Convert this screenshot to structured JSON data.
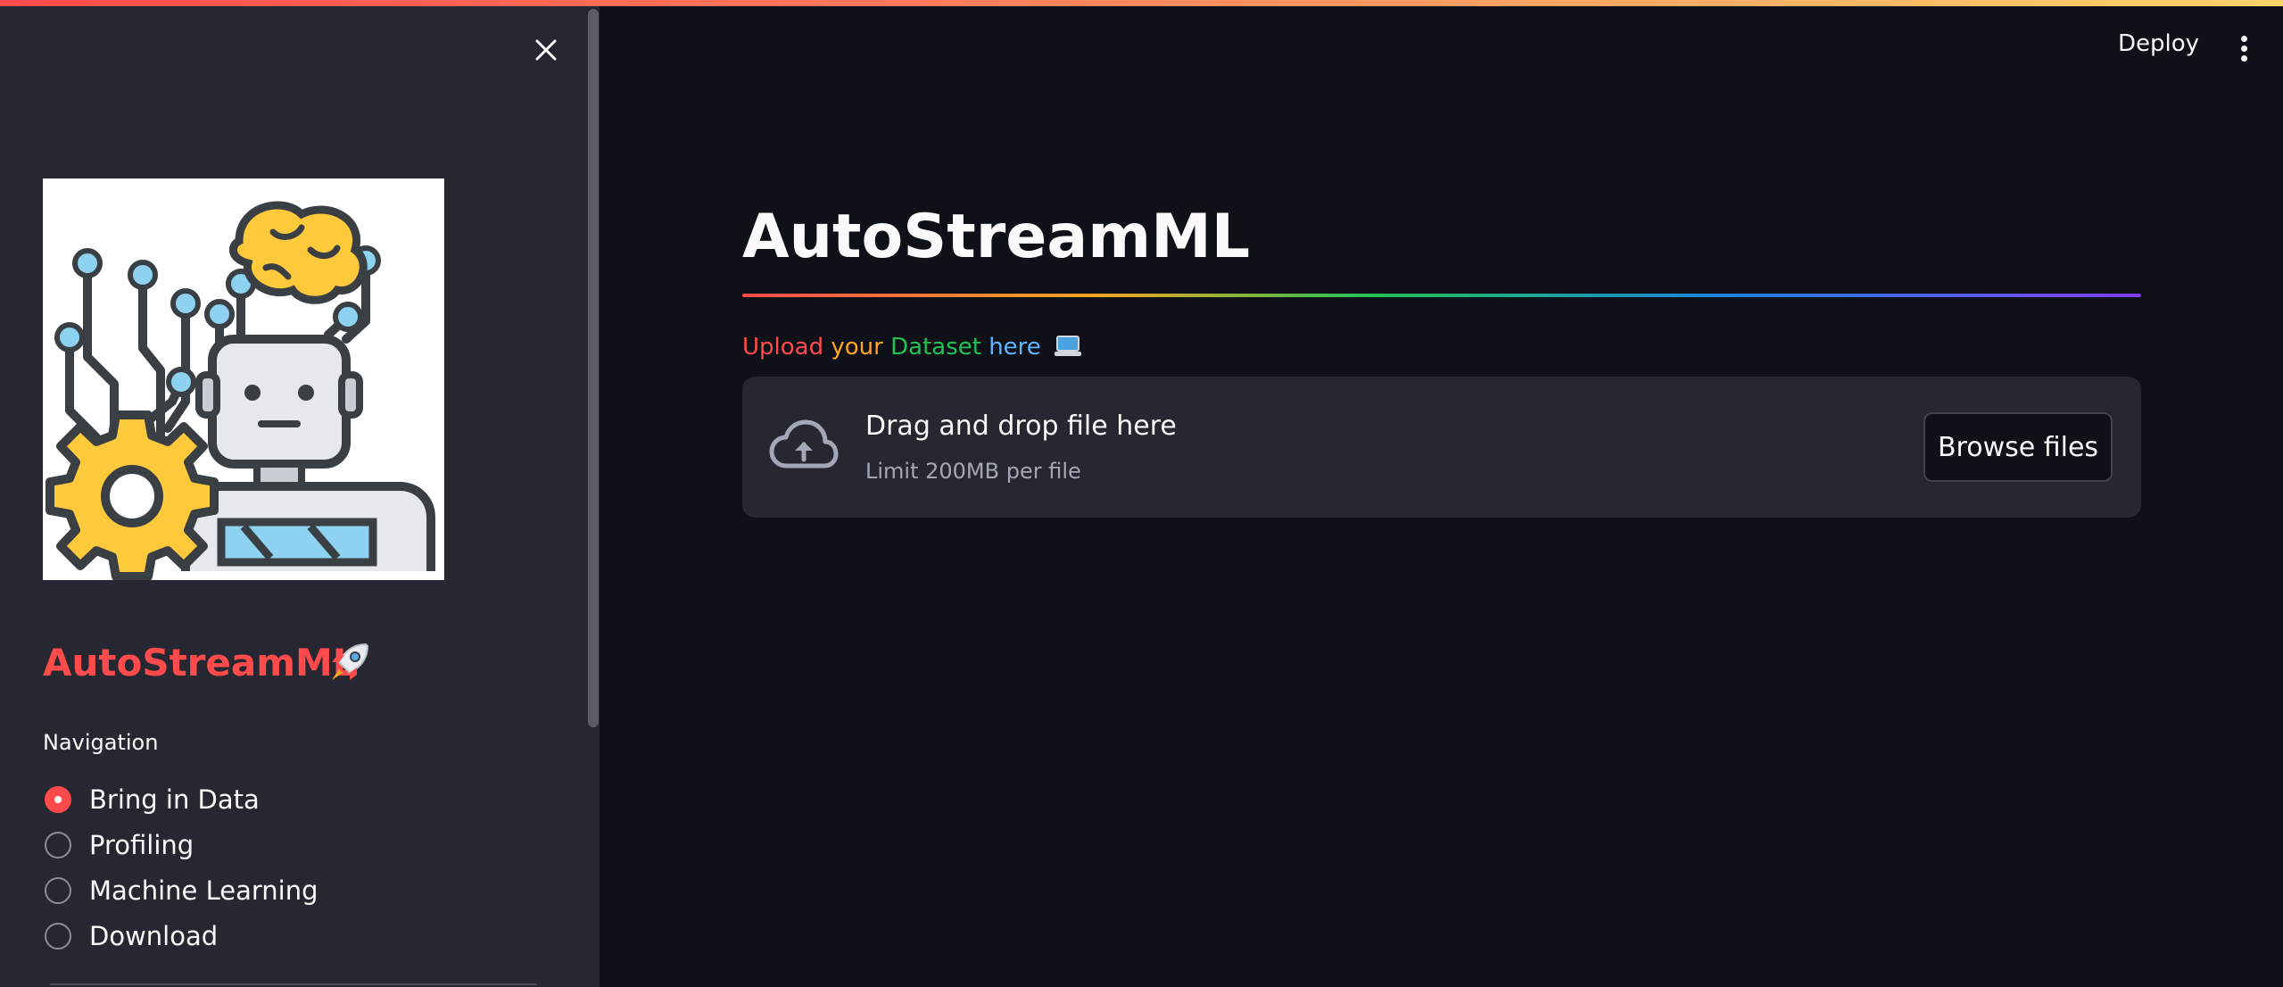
{
  "app": {
    "name": "AutoStreamML"
  },
  "header": {
    "deploy_label": "Deploy",
    "menu_icon": "kebab-menu-icon"
  },
  "sidebar": {
    "close_icon": "close-icon",
    "logo_icon": "robot-brain-gear-illustration",
    "title": "AutoStreamML",
    "title_icon": "rocket-icon",
    "nav_label": "Navigation",
    "nav_items": [
      {
        "label": "Bring in Data",
        "selected": true
      },
      {
        "label": "Profiling",
        "selected": false
      },
      {
        "label": "Machine Learning",
        "selected": false
      },
      {
        "label": "Download",
        "selected": false
      }
    ]
  },
  "main": {
    "title": "AutoStreamML",
    "upload_label_words": [
      "Upload",
      "your",
      "Dataset",
      "here"
    ],
    "upload_label_icon": "laptop-icon",
    "uploader": {
      "icon": "cloud-upload-icon",
      "drag_text": "Drag and drop file here",
      "limit_text": "Limit 200MB per file",
      "browse_label": "Browse files"
    }
  },
  "colors": {
    "accent": "#ff4b4b",
    "background": "#0e1117",
    "sidebar_background": "#262730",
    "upload_word_colors": [
      "#ff4b4b",
      "#ffa421",
      "#21c354",
      "#60b4ff"
    ]
  }
}
